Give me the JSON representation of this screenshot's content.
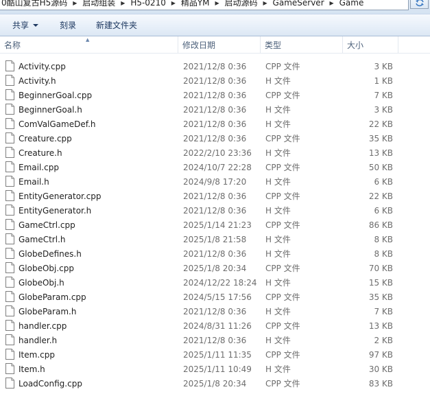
{
  "address_bar": {
    "breadcrumbs": [
      "0酷山复古H5源码",
      "启动组装",
      "H5-0210",
      "精品YM",
      "启动源码",
      "GameServer",
      "Game"
    ]
  },
  "toolbar": {
    "share_label": "共享",
    "burn_label": "刻录",
    "new_folder_label": "新建文件夹"
  },
  "columns": {
    "name": "名称",
    "date": "修改日期",
    "type": "类型",
    "size": "大小"
  },
  "files": [
    {
      "name": "Activity.cpp",
      "date": "2021/12/8 0:36",
      "type": "CPP 文件",
      "size": "3 KB"
    },
    {
      "name": "Activity.h",
      "date": "2021/12/8 0:36",
      "type": "H 文件",
      "size": "1 KB"
    },
    {
      "name": "BeginnerGoal.cpp",
      "date": "2021/12/8 0:36",
      "type": "CPP 文件",
      "size": "7 KB"
    },
    {
      "name": "BeginnerGoal.h",
      "date": "2021/12/8 0:36",
      "type": "H 文件",
      "size": "3 KB"
    },
    {
      "name": "ComValGameDef.h",
      "date": "2021/12/8 0:36",
      "type": "H 文件",
      "size": "22 KB"
    },
    {
      "name": "Creature.cpp",
      "date": "2021/12/8 0:36",
      "type": "CPP 文件",
      "size": "35 KB"
    },
    {
      "name": "Creature.h",
      "date": "2022/2/10 23:36",
      "type": "H 文件",
      "size": "13 KB"
    },
    {
      "name": "Email.cpp",
      "date": "2024/10/7 22:28",
      "type": "CPP 文件",
      "size": "50 KB"
    },
    {
      "name": "Email.h",
      "date": "2024/9/8 17:20",
      "type": "H 文件",
      "size": "6 KB"
    },
    {
      "name": "EntityGenerator.cpp",
      "date": "2021/12/8 0:36",
      "type": "CPP 文件",
      "size": "22 KB"
    },
    {
      "name": "EntityGenerator.h",
      "date": "2021/12/8 0:36",
      "type": "H 文件",
      "size": "6 KB"
    },
    {
      "name": "GameCtrl.cpp",
      "date": "2025/1/14 21:23",
      "type": "CPP 文件",
      "size": "86 KB"
    },
    {
      "name": "GameCtrl.h",
      "date": "2025/1/8 21:58",
      "type": "H 文件",
      "size": "8 KB"
    },
    {
      "name": "GlobeDefines.h",
      "date": "2021/12/8 0:36",
      "type": "H 文件",
      "size": "8 KB"
    },
    {
      "name": "GlobeObj.cpp",
      "date": "2025/1/8 20:34",
      "type": "CPP 文件",
      "size": "70 KB"
    },
    {
      "name": "GlobeObj.h",
      "date": "2024/12/22 18:24",
      "type": "H 文件",
      "size": "15 KB"
    },
    {
      "name": "GlobeParam.cpp",
      "date": "2024/5/15 17:56",
      "type": "CPP 文件",
      "size": "35 KB"
    },
    {
      "name": "GlobeParam.h",
      "date": "2021/12/8 0:36",
      "type": "H 文件",
      "size": "7 KB"
    },
    {
      "name": "handler.cpp",
      "date": "2024/8/31 11:26",
      "type": "CPP 文件",
      "size": "13 KB"
    },
    {
      "name": "handler.h",
      "date": "2021/12/8 0:36",
      "type": "H 文件",
      "size": "2 KB"
    },
    {
      "name": "Item.cpp",
      "date": "2025/1/11 11:35",
      "type": "CPP 文件",
      "size": "97 KB"
    },
    {
      "name": "Item.h",
      "date": "2025/1/11 10:49",
      "type": "H 文件",
      "size": "30 KB"
    },
    {
      "name": "LoadConfig.cpp",
      "date": "2025/1/8 20:34",
      "type": "CPP 文件",
      "size": "83 KB"
    }
  ]
}
